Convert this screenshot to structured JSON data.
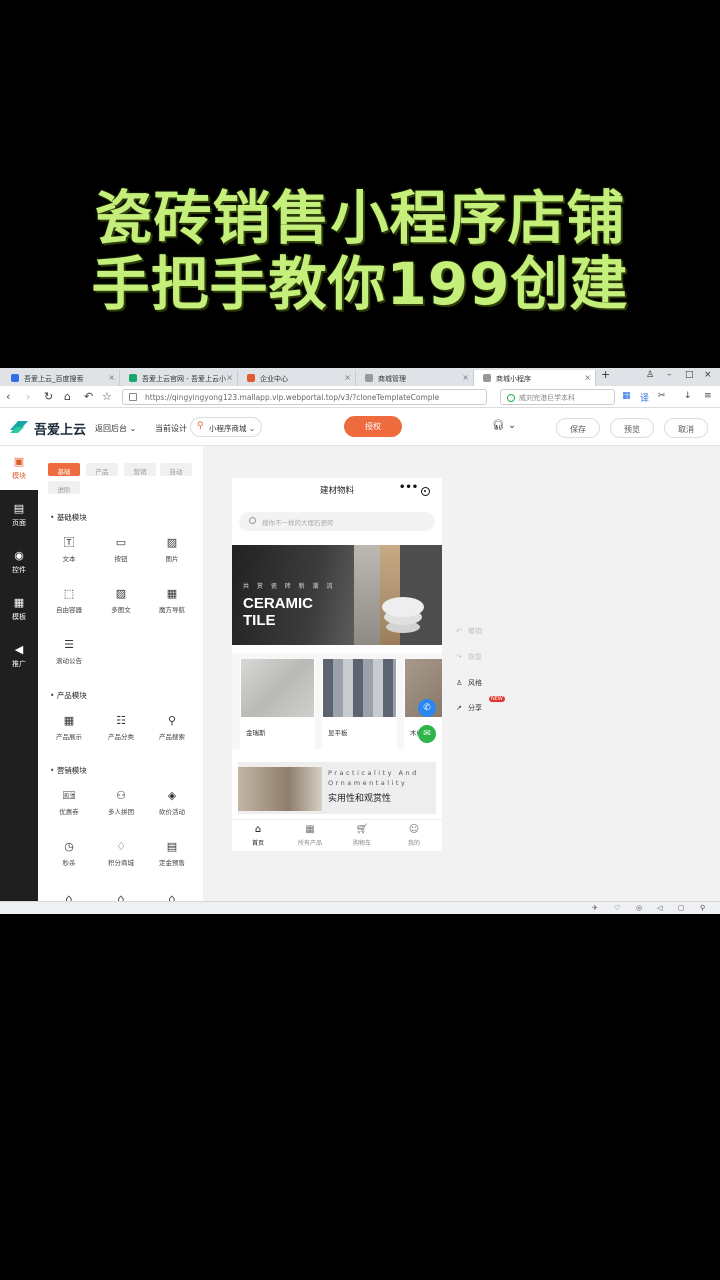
{
  "headline": {
    "line1": "瓷砖销售小程序店铺",
    "line2": "手把手教你199创建"
  },
  "browser": {
    "tabs": [
      {
        "label": "吾爱上云_百度搜索",
        "color": "#2f6ee6"
      },
      {
        "label": "吾爱上云官网 - 吾爱上云小",
        "color": "#19a66b"
      },
      {
        "label": "企业中心",
        "color": "#e05a2b"
      },
      {
        "label": "商城管理",
        "color": "#777777"
      },
      {
        "label": "商城小程序",
        "color": "#777777"
      }
    ],
    "url": "https://qingyingyong123.mallapp.vip.webportal.top/v3/?cloneTemplateComple",
    "search_text": "威刘完港巨学本科"
  },
  "app": {
    "logo_text": "吾爱上云",
    "back_label": "返回后台",
    "current_design_label": "当前设计",
    "store_select": "小程序商城",
    "publish_label": "授权",
    "save_label": "保存",
    "preview_label": "预览",
    "cancel_label": "取消"
  },
  "left_nav": [
    {
      "label": "模块",
      "icon": "module-icon"
    },
    {
      "label": "页面",
      "icon": "page-icon"
    },
    {
      "label": "控件",
      "icon": "toggle-icon"
    },
    {
      "label": "模板",
      "icon": "template-icon"
    },
    {
      "label": "推广",
      "icon": "megaphone-icon"
    }
  ],
  "panel": {
    "tabs": [
      "基础",
      "产品",
      "营销",
      "自动",
      "进阶"
    ],
    "basic_title": "基础模块",
    "basic_widgets": [
      "文本",
      "按钮",
      "图片",
      "自由容器",
      "多图文",
      "魔方导航",
      "滚动公告"
    ],
    "product_title": "产品模块",
    "product_widgets": [
      "产品展示",
      "产品分类",
      "产品搜索"
    ],
    "marketing_title": "营销模块",
    "marketing_widgets": [
      "优惠券",
      "多人拼团",
      "砍价活动",
      "秒杀",
      "积分商城",
      "定金预售"
    ]
  },
  "phone": {
    "title": "建材物料",
    "search_placeholder": "搜你不一样的大理石瓷砖",
    "banner_sub": "共 赏 瓷 砖 新 潮 流",
    "banner_title_1": "CERAMIC",
    "banner_title_2": "TILE",
    "products": [
      "金瑞斯",
      "显平板",
      "木纹砖"
    ],
    "strip_en": "Practicality And Ornamentality",
    "strip_cn": "实用性和观赏性",
    "bottom_tabs": [
      "首页",
      "所有产品",
      "购物车",
      "我的"
    ]
  },
  "right_tools": [
    {
      "label": "撤销",
      "enabled": false
    },
    {
      "label": "恢复",
      "enabled": false
    },
    {
      "label": "风格",
      "enabled": true
    },
    {
      "label": "分享",
      "enabled": true,
      "badge": "NEW"
    }
  ],
  "colors": {
    "accent": "#ee6b3e",
    "headline": "#c4ef7a",
    "sidebar": "#1f1f1f"
  }
}
